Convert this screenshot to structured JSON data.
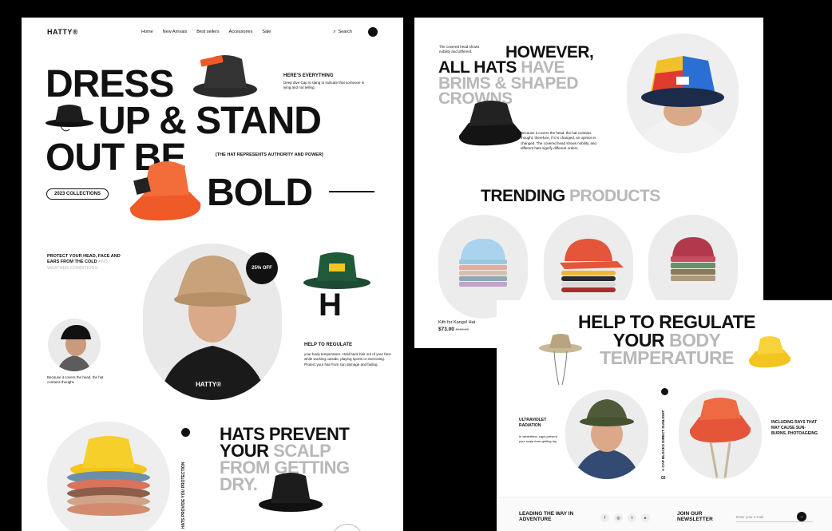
{
  "nav": {
    "logo": "HATTY®",
    "links": [
      "Home",
      "New Arrivals",
      "Best sellers",
      "Accessories",
      "Sale"
    ],
    "search": "Search"
  },
  "hero": {
    "line1": "DRESS",
    "line2": "UP & STAND",
    "line3": "OUT BE",
    "line4": "BOLD",
    "heres_title": "HERE'S EVERYTHING",
    "heres_text": "Deep dive Cap is slang to indicate that someone is lying and not telling.",
    "authority": "[THE HAT REPRESENTS AUTHORITY AND POWER]",
    "collections_btn": "2023 COLLECTIONS"
  },
  "protect": {
    "title_dark": "PROTECT YOUR HEAD, FACE AND EARS FROM THE COLD",
    "title_grey": "AND WEATHER CONDITIONS.",
    "badge": "25% OFF",
    "covers_text": "Because it covers the head, the hat contains thought.",
    "model_logo": "HATTY®",
    "regulate_title": "HELP TO REGULATE",
    "regulate_text": "your body temperature. Hold back hair out of your face while working outside, playing sports or exercising. Protect your hair from sun damage and fading"
  },
  "prevent": {
    "line1_dark": "HATS PREVENT",
    "line2_dark": "YOUR",
    "line2_grey": "SCALP",
    "line3_grey": "FROM GETTING",
    "line4_grey": "DRY.",
    "vertical": "HATS PROVIDE YOU PROTECTION"
  },
  "however": {
    "intro": "The covered head shows nobility and different.",
    "line1": "HOWEVER,",
    "line2_dark": "ALL HATS",
    "line2_grey": "HAVE",
    "line3_grey": "BRIMS & SHAPED",
    "line4_grey": "CROWNS",
    "text": "Because it covers the head, the hat contains thought; therefore, if it is changed, an opinion is changed. The covered head shows nobility, and different hats signify different orders."
  },
  "trending": {
    "title_dark": "TRENDING",
    "title_grey": "PRODUCTS",
    "product_name": "Kith for Kangol Hat",
    "price": "$73.00",
    "old_price": "$100.00"
  },
  "regulate2": {
    "line1": "HELP TO REGULATE",
    "line2_dark": "YOUR",
    "line2_grey": "BODY",
    "line3_grey": "TEMPERATURE",
    "uv": "ULTRAVIOLET RADIATION",
    "uv_text": "In wintertime, caps prevent your scalp from getting dry.",
    "vertical": "A CAP BLOCKS DIRECT SUNLIGHT",
    "page_no": "02",
    "rays": "INCLUDING RAYS THAT MAY CAUSE SUN-BURNS, PHOTOAGEING",
    "leading": "LEADING THE WAY IN ADVENTURE",
    "newsletter": "JOIN OUR NEWSLETTER",
    "email_placeholder": "Enter your e-mail"
  },
  "colors": {
    "accent_orange": "#f05a28",
    "grey_text": "#b8b8b8",
    "yellow": "#f4c51e",
    "green": "#1f5a3a"
  }
}
